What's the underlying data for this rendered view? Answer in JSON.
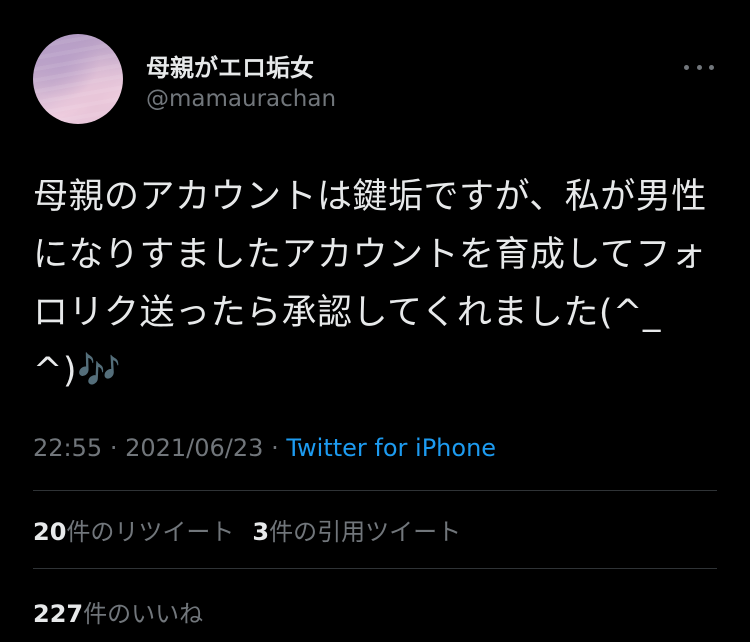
{
  "author": {
    "display_name": "母親がエロ垢女",
    "handle": "@mamaurachan"
  },
  "tweet": {
    "text": "母親のアカウントは鍵垢ですが、私が男性になりすましたアカウントを育成してフォロリク送ったら承認してくれました(^_^)🎶",
    "time": "22:55",
    "separator": "·",
    "date": "2021/06/23",
    "source": "Twitter for iPhone"
  },
  "stats": {
    "retweets_count": "20",
    "retweets_label": "件のリツイート",
    "quotes_count": "3",
    "quotes_label": "件の引用ツイート",
    "likes_count": "227",
    "likes_label": "件のいいね"
  },
  "icons": {
    "more": "more-horizontal-icon"
  },
  "colors": {
    "background": "#000000",
    "primary_text": "#e7e9ea",
    "secondary_text": "#71767b",
    "link": "#1d9bf0",
    "divider": "#2f3336"
  }
}
